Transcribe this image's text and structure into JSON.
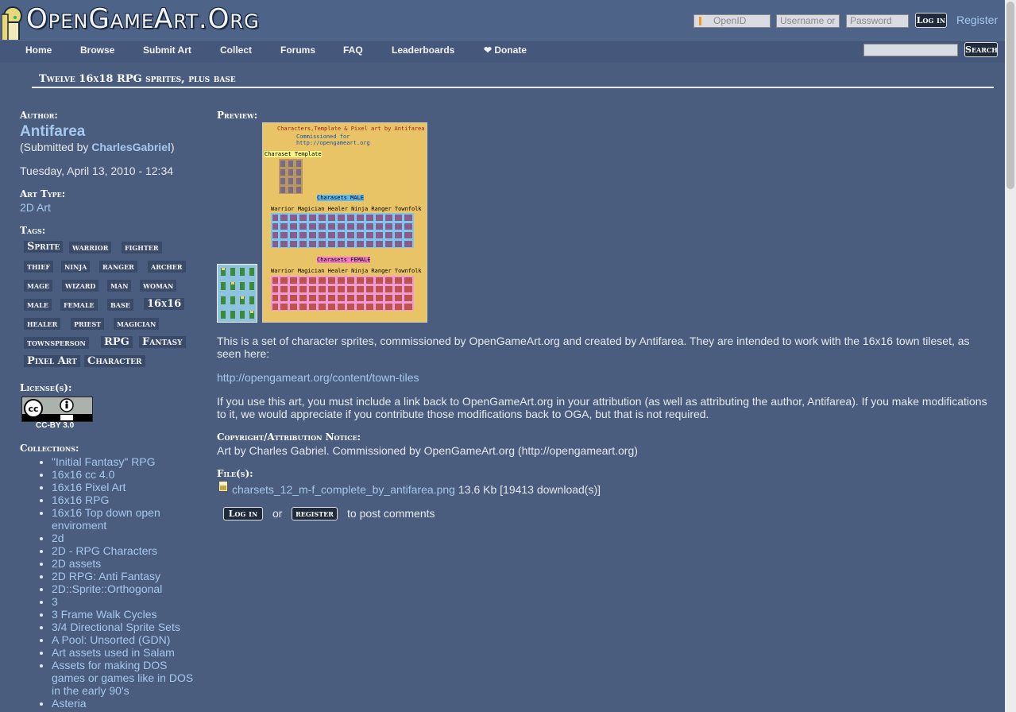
{
  "site": {
    "logo_text": "OpenGameArt.Org"
  },
  "login": {
    "openid": "OpenID",
    "username_placeholder": "Username or",
    "password_placeholder": "Password",
    "login_label": "Log in",
    "register_label": "Register"
  },
  "nav": {
    "items": [
      "Home",
      "Browse",
      "Submit Art",
      "Collect",
      "Forums",
      "FAQ",
      "Leaderboards",
      "❤ Donate"
    ],
    "search_label": "Search"
  },
  "page": {
    "title": "Twelve 16x18 RPG sprites, plus base"
  },
  "sidebar": {
    "author_label": "Author:",
    "author": "Antifarea",
    "submitted_prefix": "(Submitted by ",
    "submitted_by": "CharlesGabriel",
    "submitted_suffix": ")",
    "date": "Tuesday, April 13, 2010 - 12:34",
    "art_type_label": "Art Type:",
    "art_type": "2D Art",
    "tags_label": "Tags:",
    "tags": [
      "Sprite",
      "warrior",
      "fighter",
      "thief",
      "ninja",
      "ranger",
      "archer",
      "mage",
      "wizard",
      "man",
      "woman",
      "male",
      "female",
      "base",
      "16x16",
      "healer",
      "priest",
      "magician",
      "townsperson",
      "RPG",
      "Fantasy",
      "Pixel Art",
      "Character"
    ],
    "license_label": "License(s):",
    "license": "CC-BY 3.0",
    "collections_label": "Collections:",
    "collections": [
      "\"Initial Fantasy\" RPG",
      "16x16 cc 4.0",
      "16x16 Pixel Art",
      "16x16 RPG",
      "16x16 Top down open enviroment",
      "2d",
      "2D - RPG Characters",
      "2D assets",
      "2D RPG: Anti Fantasy",
      "2D::Sprite::Orthogonal",
      "3",
      "3 Frame Walk Cycles",
      "3/4 Directional Sprite Sets",
      "A Pool: Unsorted (GDN)",
      "Art assets used in Salam",
      "Assets for making DOS games or games like in DOS in the early 90's",
      "Asteria"
    ]
  },
  "main": {
    "preview_label": "Preview:",
    "preview_image": {
      "line1": "Characters,Template & Pixel art by Antifarea",
      "line2": "Commissioned for http://opengameart.org",
      "template": "Charaset Template",
      "male": "Charasets MALE",
      "female": "Charasets FEMALE",
      "classes": "Warrior Magician Healer Ninja Ranger Townfolk"
    },
    "description": "This is a set of character sprites, commissioned by OpenGameArt.org and created by Antifarea.  They are intended to work with the 16x16 town tileset, as seen here:",
    "link": "http://opengameart.org/content/town-tiles",
    "attribution_text": "If you use this art, you must include a link back to OpenGameArt.org in your attribution (as well as attributing the author, Antifarea).  If you make modifications to it, we would appreciate if you contribute those modifications back to OGA, but that is not required.",
    "copyright_label": "Copyright/Attribution Notice:",
    "copyright_text": "Art by Charles Gabriel. Commissioned by OpenGameArt.org (http://opengameart.org)",
    "files_label": "File(s):",
    "file_name": "charsets_12_m-f_complete_by_antifarea.png",
    "file_info": "13.6 Kb [19413 download(s)]",
    "comment_login": "Log in",
    "comment_or": "or",
    "comment_register": "register",
    "comment_suffix": "to post comments"
  }
}
